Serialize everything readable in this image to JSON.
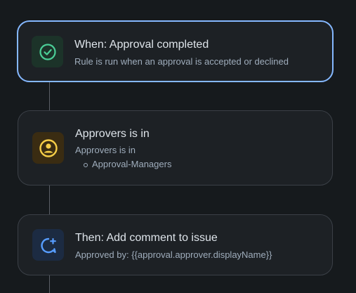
{
  "rules": [
    {
      "kind": "trigger",
      "title": "When: Approval completed",
      "description": "Rule is run when an approval is accepted or declined",
      "icon": "check-circle-icon",
      "icon_bg": "#1c3329",
      "icon_color": "#4bce97",
      "selected": true
    },
    {
      "kind": "condition",
      "title": "Approvers is in",
      "description": "Approvers is in",
      "values": [
        "Approval-Managers"
      ],
      "icon": "user-circle-icon",
      "icon_bg": "#3a2c12",
      "icon_color": "#f5cd47",
      "selected": false
    },
    {
      "kind": "action",
      "title": "Then: Add comment to issue",
      "description": "Approved by: {{approval.approver.displayName}}",
      "icon": "add-comment-icon",
      "icon_bg": "#1c2b42",
      "icon_color": "#579dff",
      "selected": false
    }
  ],
  "colors": {
    "background": "#161a1d",
    "card": "#1d2125",
    "card_border": "#3b4047",
    "selected_border": "#85b8ff",
    "connector": "#5a5f66"
  }
}
